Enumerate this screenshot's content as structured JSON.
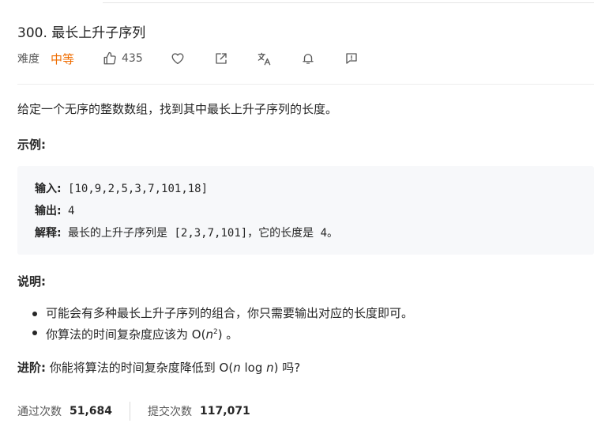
{
  "problem": {
    "title": "300. 最长上升子序列",
    "difficulty_label": "难度",
    "difficulty": "中等",
    "likes": "435",
    "colors": {
      "difficulty": "#ef6c00"
    },
    "icons": [
      "thumbs-up-icon",
      "heart-icon",
      "share-icon",
      "translate-icon",
      "bell-icon",
      "feedback-icon"
    ]
  },
  "content": {
    "description": "给定一个无序的整数数组，找到其中最长上升子序列的长度。",
    "example_heading": "示例:",
    "example": {
      "input_label": "输入:",
      "input_value": " [10,9,2,5,3,7,101,18]",
      "output_label": "输出:",
      "output_value": " 4",
      "explain_label": "解释:",
      "explain_value": " 最长的上升子序列是 [2,3,7,101]，它的长度是 4。"
    },
    "note_heading": "说明:",
    "notes": [
      "可能会有多种最长上升子序列的组合，你只需要输出对应的长度即可。",
      "你算法的时间复杂度应该为 O("
    ],
    "note2_var": "n",
    "note2_sup": "2",
    "note2_tail": ") 。",
    "advance_label": "进阶:",
    "advance_text": " 你能将算法的时间复杂度降低到 O(",
    "advance_var1": "n",
    "advance_mid": " log ",
    "advance_var2": "n",
    "advance_tail": ") 吗?"
  },
  "stats": {
    "accepted_label": "通过次数",
    "accepted_value": "51,684",
    "submissions_label": "提交次数",
    "submissions_value": "117,071"
  }
}
